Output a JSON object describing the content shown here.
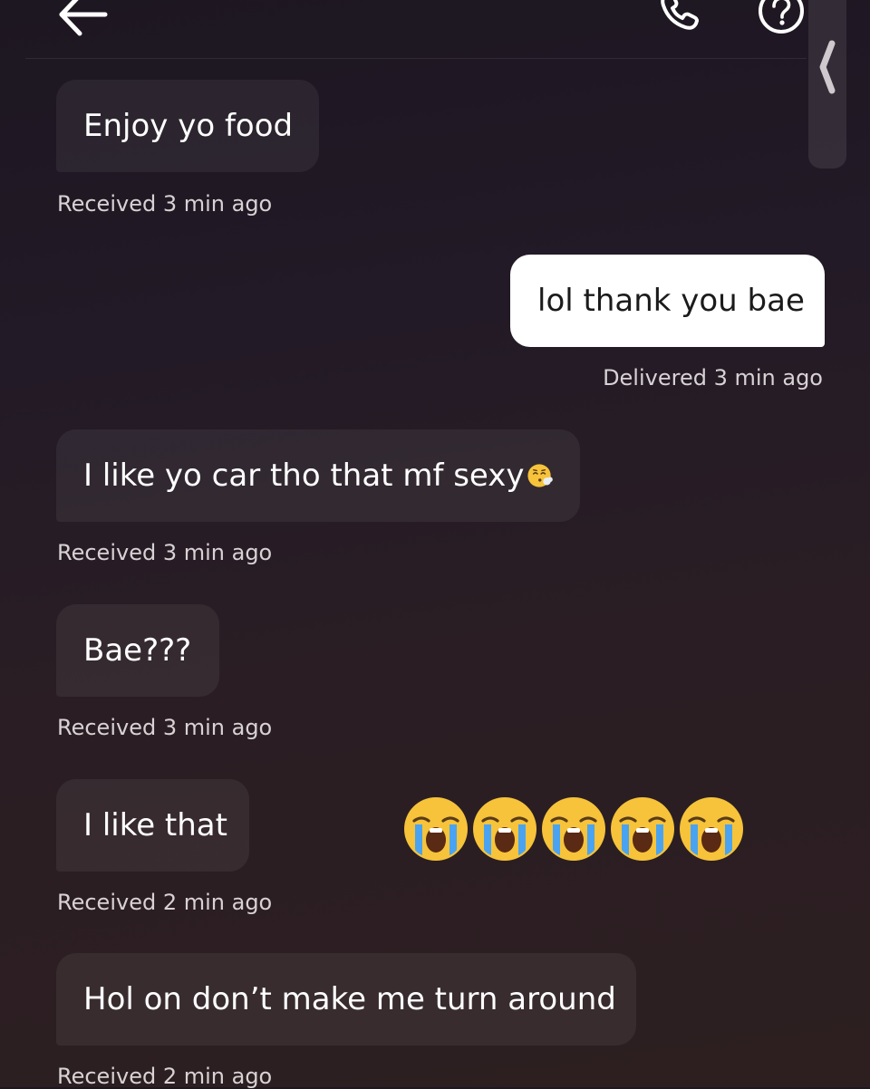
{
  "header": {
    "back_icon": "arrow-left-icon",
    "call_icon": "phone-icon",
    "help_icon": "help-circle-icon",
    "side_tab_icon": "chevron-left-icon"
  },
  "messages": [
    {
      "direction": "received",
      "text": "Enjoy yo food",
      "status": "Received 3 min ago"
    },
    {
      "direction": "sent",
      "text": "lol thank you bae",
      "status": "Delivered 3 min ago"
    },
    {
      "direction": "received",
      "text": "I like yo car tho that mf sexy",
      "emoji": "😮‍💨",
      "status": "Received 3 min ago"
    },
    {
      "direction": "received",
      "text": "Bae???",
      "status": "Received 3 min ago"
    },
    {
      "direction": "received",
      "text": "I like that",
      "status": "Received 2 min ago"
    },
    {
      "direction": "received",
      "text": "Hol on don’t make me turn around",
      "status": "Received 2 min ago"
    }
  ],
  "overlay_emojis": [
    "😭",
    "😭",
    "😭",
    "😭",
    "😭"
  ],
  "colors": {
    "background": "#221a26",
    "received_bubble": "#2e272f",
    "sent_bubble": "#ffffff",
    "status_text": "#d8d2d4"
  }
}
